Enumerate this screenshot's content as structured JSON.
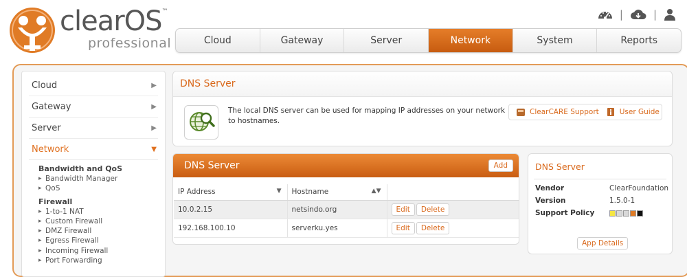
{
  "brand": {
    "name": "clearOS",
    "trademark": "™",
    "edition": "professional",
    "logo_icon": "clearos-logo-mark"
  },
  "top_icons": [
    "dashboard-icon",
    "download-icon",
    "user-icon"
  ],
  "nav": {
    "tabs": [
      {
        "label": "Cloud",
        "active": false
      },
      {
        "label": "Gateway",
        "active": false
      },
      {
        "label": "Server",
        "active": false
      },
      {
        "label": "Network",
        "active": true
      },
      {
        "label": "System",
        "active": false
      },
      {
        "label": "Reports",
        "active": false
      }
    ]
  },
  "sidebar": {
    "items": [
      {
        "label": "Cloud",
        "arrow": "▶"
      },
      {
        "label": "Gateway",
        "arrow": "▶"
      },
      {
        "label": "Server",
        "arrow": "▶"
      },
      {
        "label": "Network",
        "arrow": "▼"
      }
    ],
    "groups": [
      {
        "heading": "Bandwidth and QoS",
        "links": [
          "Bandwidth Manager",
          "QoS"
        ]
      },
      {
        "heading": "Firewall",
        "links": [
          "1-to-1 NAT",
          "Custom Firewall",
          "DMZ Firewall",
          "Egress Firewall",
          "Incoming Firewall",
          "Port Forwarding"
        ]
      }
    ]
  },
  "app_panel": {
    "title": "DNS Server",
    "icon": "dns-globe-search-icon",
    "description": "The local DNS server can be used for mapping IP addresses on your network to hostnames.",
    "support_label": "ClearCARE Support",
    "guide_label": "User Guide"
  },
  "dns_table": {
    "title": "DNS Server",
    "add_label": "Add",
    "columns": [
      {
        "label": "IP Address",
        "sort": "▼"
      },
      {
        "label": "Hostname",
        "sort": "▲▼"
      },
      {
        "label": ""
      }
    ],
    "rows": [
      {
        "ip": "10.0.2.15",
        "hostname": "netsindo.org",
        "edit": "Edit",
        "delete": "Delete"
      },
      {
        "ip": "192.168.100.10",
        "hostname": "serverku.yes",
        "edit": "Edit",
        "delete": "Delete"
      }
    ]
  },
  "info_panel": {
    "title": "DNS Server",
    "vendor_label": "Vendor",
    "vendor": "ClearFoundation",
    "version_label": "Version",
    "version": "1.5.0-1",
    "policy_label": "Support Policy",
    "policy_colors": [
      "#f5e642",
      "#d8d8d8",
      "#d8d8d8",
      "#e07b25",
      "#111111"
    ],
    "details_label": "App Details"
  },
  "colors": {
    "accent": "#e0701f",
    "frame_border": "#e39b57"
  }
}
